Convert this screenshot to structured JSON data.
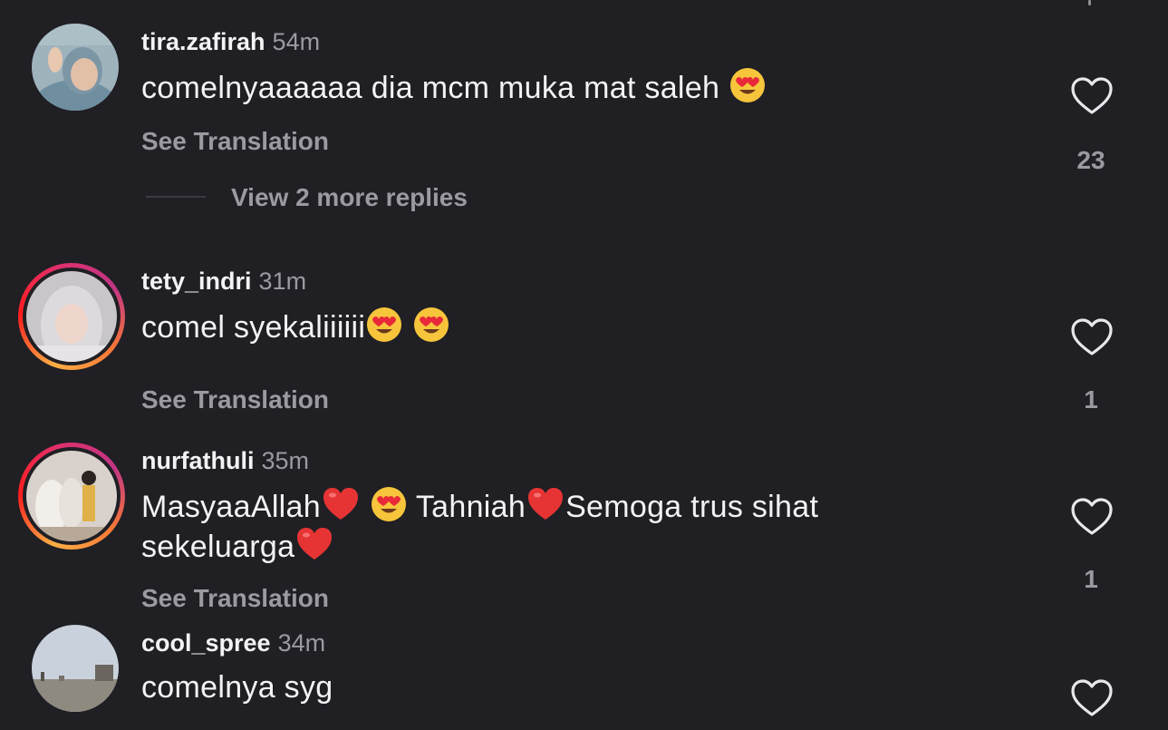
{
  "comments": [
    {
      "username": "tira.zafirah",
      "time": "54m",
      "text_parts": [
        "comelnyaaaaaa dia mcm muka mat saleh "
      ],
      "see_translation": "See Translation",
      "likes": "23",
      "view_replies": "View 2 more replies"
    },
    {
      "username": "tety_indri",
      "time": "31m",
      "text_parts": [
        "comel syekaliiiiii"
      ],
      "see_translation": "See Translation",
      "likes": "1"
    },
    {
      "username": "nurfathuli",
      "time": "35m",
      "text_parts": [
        "MasyaaAllah",
        " Tahniah",
        "Semoga trus sihat",
        "sekeluarga"
      ],
      "see_translation": "See Translation",
      "likes": "1"
    },
    {
      "username": "cool_spree",
      "time": "34m",
      "text_parts": [
        "comelnya syg"
      ]
    }
  ],
  "icons": {
    "like": "heart-outline-icon",
    "emoji_love": "heart-eyes-emoji",
    "emoji_heart": "red-heart-emoji"
  },
  "colors": {
    "background": "#1f1f24",
    "primary_text": "#f3f3f5",
    "secondary_text": "#9a9aa0"
  }
}
